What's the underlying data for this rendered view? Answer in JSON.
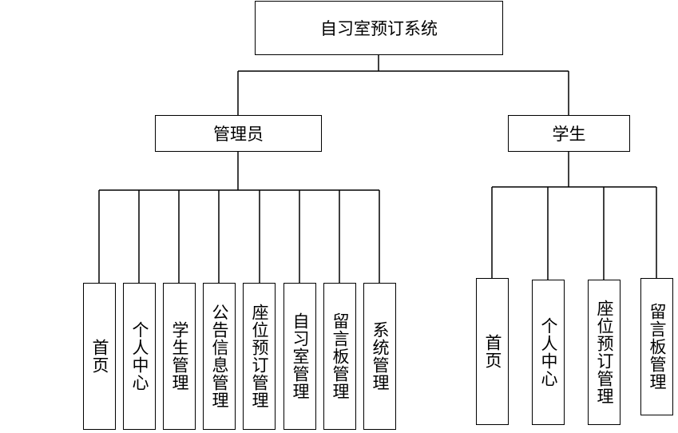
{
  "root": {
    "label": "自习室预订系统"
  },
  "roles": [
    {
      "label": "管理员",
      "modules": [
        "首页",
        "个人中心",
        "学生管理",
        "公告信息管理",
        "座位预订管理",
        "自习室管理",
        "留言板管理",
        "系统管理"
      ]
    },
    {
      "label": "学生",
      "modules": [
        "首页",
        "个人中心",
        "座位预订管理",
        "留言板管理"
      ]
    }
  ]
}
